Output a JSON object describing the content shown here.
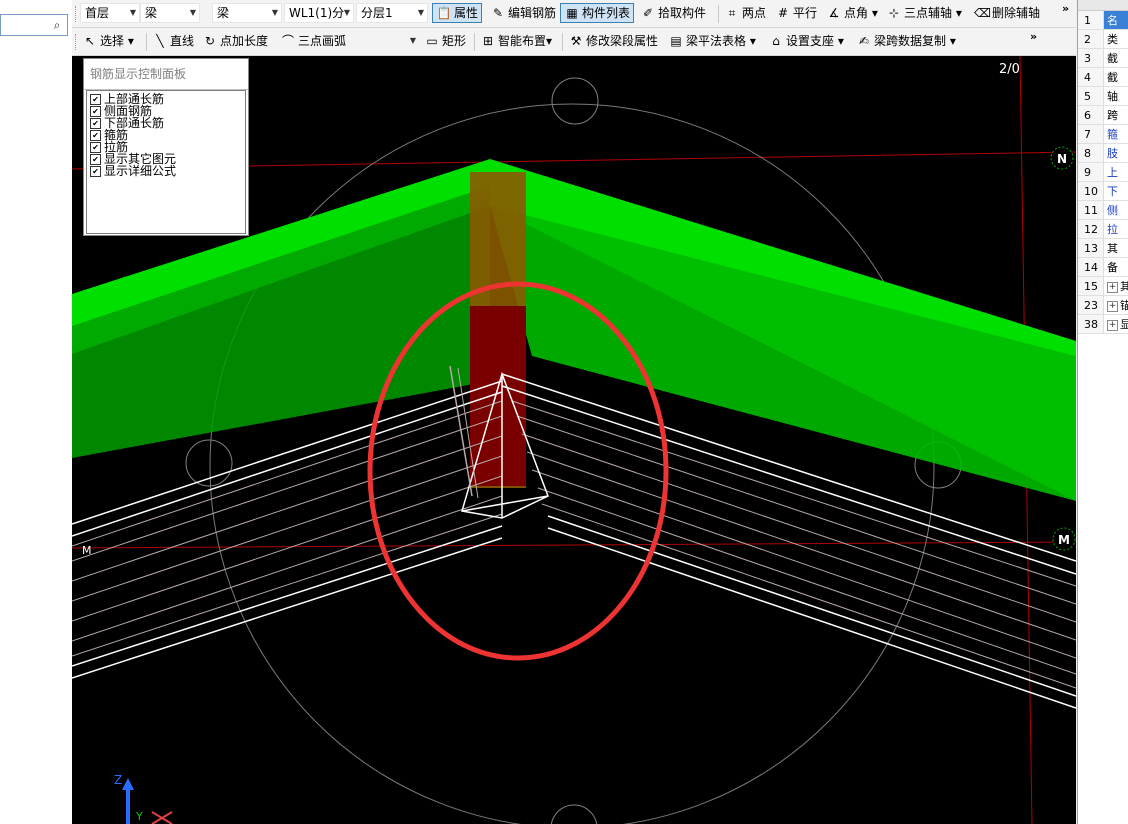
{
  "toolbar1": {
    "floor": "首层",
    "category": "梁",
    "type": "梁",
    "component": "WL1(1)分",
    "layer": "分层1",
    "properties": "属性",
    "edit_rebar": "编辑钢筋",
    "component_list": "构件列表",
    "pick_component": "拾取构件",
    "two_points": "两点",
    "parallel": "平行",
    "point_angle": "点角",
    "three_point_axis": "三点辅轴",
    "delete_axis": "删除辅轴",
    "more": "»"
  },
  "toolbar2": {
    "select": "选择",
    "line": "直线",
    "point_length": "点加长度",
    "three_point_arc": "三点画弧",
    "rectangle": "矩形",
    "smart_layout": "智能布置",
    "modify_span_props": "修改梁段属性",
    "beam_table": "梁平法表格",
    "set_support": "设置支座",
    "span_copy": "梁跨数据复制",
    "more": "»"
  },
  "rebar_panel": {
    "title": "钢筋显示控制面板",
    "options": [
      "上部通长筋",
      "侧面钢筋",
      "下部通长筋",
      "箍筋",
      "拉筋",
      "显示其它图元",
      "显示详细公式"
    ]
  },
  "viewport": {
    "view_label": "2/0",
    "compass_n": "N",
    "compass_m_left": "M",
    "compass_m_right": "M",
    "axis_z": "Z",
    "axis_y": "Y",
    "colors": {
      "beam": "#00dd00",
      "column": "#7a0000",
      "highlight": "#ee3333",
      "gridline": "#cc0000"
    }
  },
  "props": {
    "rows": [
      {
        "num": "1",
        "val": "名"
      },
      {
        "num": "2",
        "val": "类"
      },
      {
        "num": "3",
        "val": "截"
      },
      {
        "num": "4",
        "val": "截"
      },
      {
        "num": "5",
        "val": "轴"
      },
      {
        "num": "6",
        "val": "跨"
      },
      {
        "num": "7",
        "val": "箍"
      },
      {
        "num": "8",
        "val": "肢"
      },
      {
        "num": "9",
        "val": "上"
      },
      {
        "num": "10",
        "val": "下"
      },
      {
        "num": "11",
        "val": "侧"
      },
      {
        "num": "12",
        "val": "拉"
      },
      {
        "num": "13",
        "val": "其"
      },
      {
        "num": "14",
        "val": "备"
      },
      {
        "num": "15",
        "val": "其"
      },
      {
        "num": "23",
        "val": "锚"
      },
      {
        "num": "38",
        "val": "显"
      }
    ]
  }
}
